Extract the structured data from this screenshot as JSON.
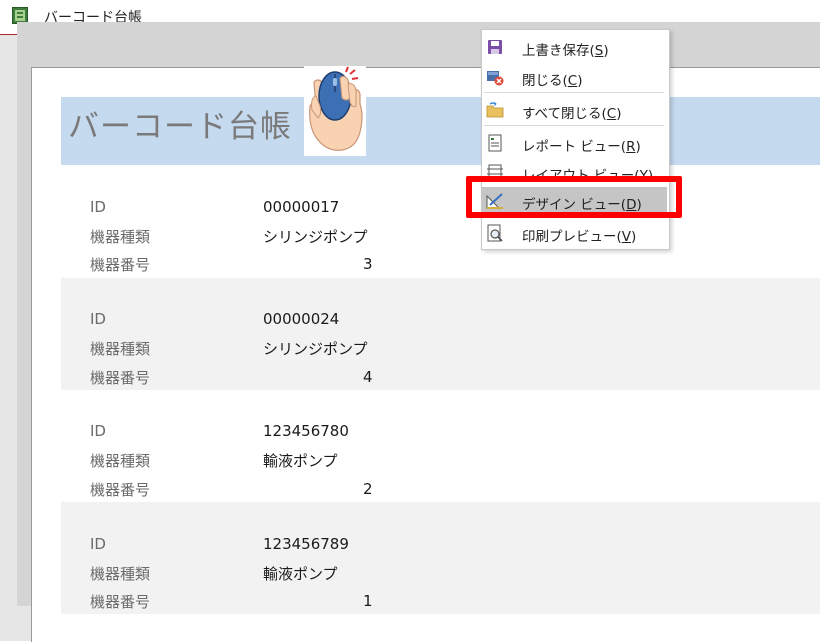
{
  "window": {
    "title": "バーコード台帳"
  },
  "report": {
    "title": "バーコード台帳",
    "field_labels": {
      "id": "ID",
      "type": "機器種類",
      "number": "機器番号"
    },
    "records": [
      {
        "id": "00000017",
        "type": "シリンジポンプ",
        "number": "3"
      },
      {
        "id": "00000024",
        "type": "シリンジポンプ",
        "number": "4"
      },
      {
        "id": "123456780",
        "type": "輸液ポンプ",
        "number": "2"
      },
      {
        "id": "123456789",
        "type": "輸液ポンプ",
        "number": "1"
      }
    ]
  },
  "context_menu": {
    "items": [
      {
        "label": "上書き保存(S)",
        "icon": "save-icon"
      },
      {
        "label": "閉じる(C)",
        "icon": "close-document-icon"
      },
      {
        "label": "すべて閉じる(C)",
        "icon": "close-all-icon"
      },
      {
        "label": "レポート ビュー(R)",
        "icon": "report-view-icon"
      },
      {
        "label": "レイアウト ビュー(Y)",
        "icon": "layout-view-icon"
      },
      {
        "label": "デザイン ビュー(D)",
        "icon": "design-view-icon"
      },
      {
        "label": "印刷プレビュー(V)",
        "icon": "print-preview-icon"
      }
    ],
    "selected_index": 5
  },
  "colors": {
    "accent_border": "#b5262b",
    "header_band": "#c5d9ef",
    "highlight_box": "#ff0000",
    "menu_selected": "#c5c5c5"
  }
}
